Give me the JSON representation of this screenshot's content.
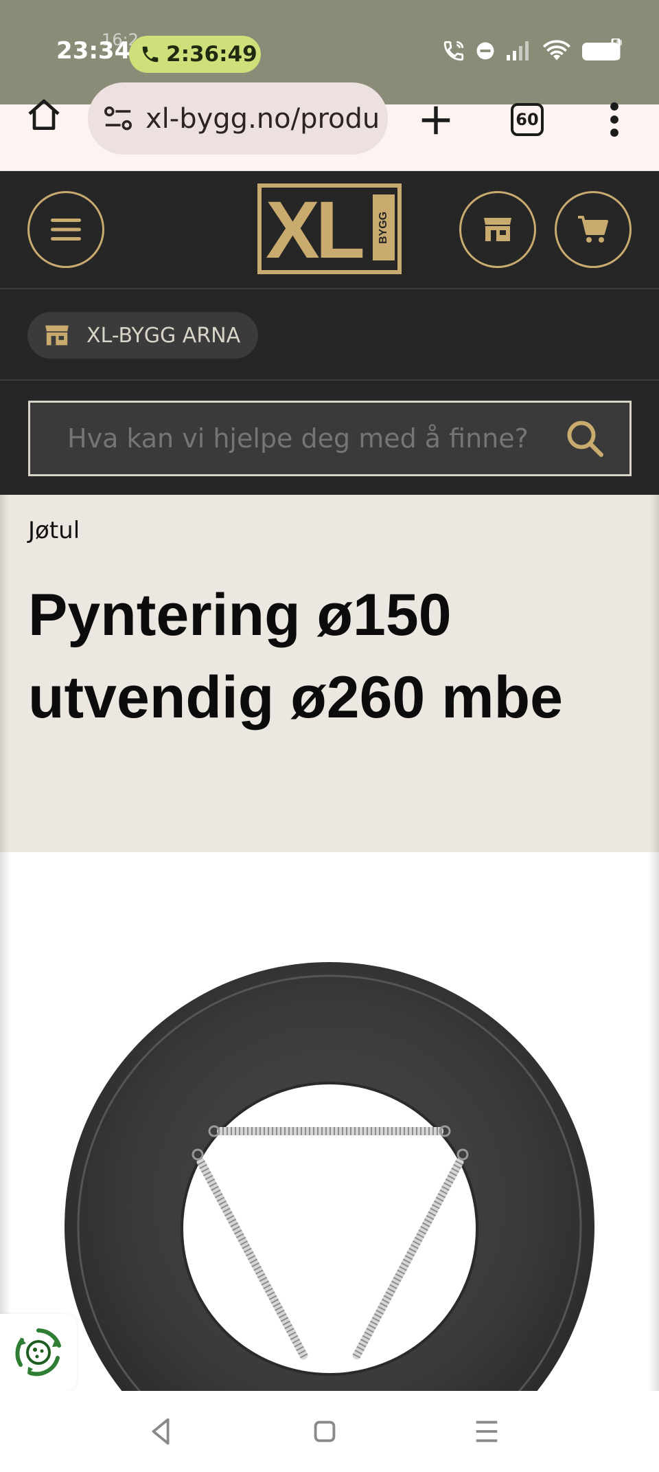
{
  "status": {
    "time": "23:34",
    "ghost_time": "16:2",
    "call_duration": "2:36:49"
  },
  "browser": {
    "url": "xl-bygg.no/produ",
    "tab_count": "60"
  },
  "header": {
    "logo_text": "XL",
    "logo_sub": "BYGG"
  },
  "store": {
    "name": "XL-BYGG ARNA"
  },
  "search": {
    "placeholder": "Hva kan vi hjelpe deg med å finne?"
  },
  "product": {
    "brand": "Jøtul",
    "title": "Pyntering ø150 utvendig ø260 mbe"
  },
  "colors": {
    "header_bg": "#262626",
    "accent_gold": "#c9aa6f",
    "title_band_bg": "#ece8e1",
    "status_bar_bg": "#8a8c78",
    "call_pill": "#cfe07a"
  },
  "icons": {
    "menu": "hamburger-icon",
    "store": "store-icon",
    "cart": "cart-icon",
    "search": "search-icon",
    "home": "home-icon",
    "cookie": "cookie-settings-icon"
  }
}
